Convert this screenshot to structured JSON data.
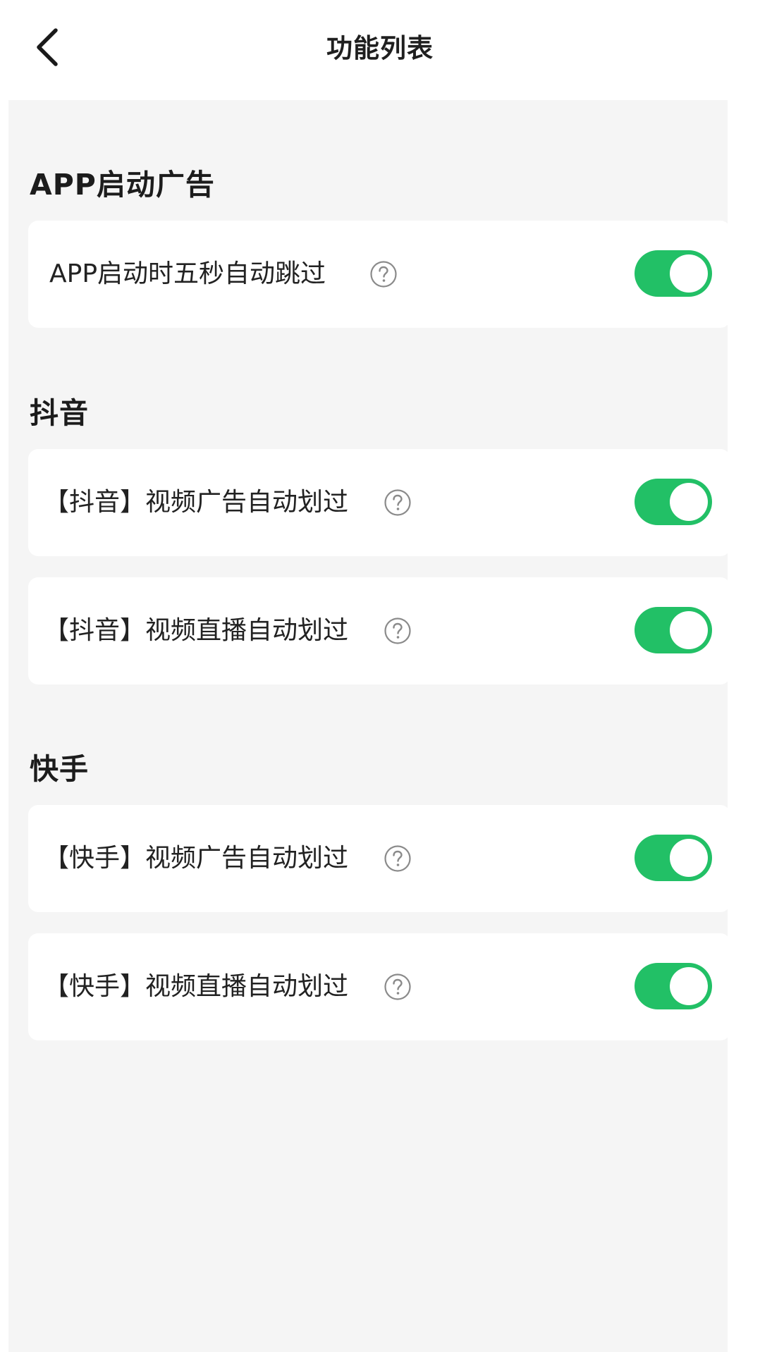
{
  "header": {
    "title": "功能列表",
    "back_icon": "chevron-left-icon"
  },
  "colors": {
    "toggle_on": "#22c066",
    "background": "#f5f5f5",
    "card": "#ffffff"
  },
  "sections": [
    {
      "title": "APP启动广告",
      "items": [
        {
          "label": "APP启动时五秒自动跳过",
          "enabled": true,
          "help_icon": "question-circle-icon"
        }
      ]
    },
    {
      "title": "抖音",
      "items": [
        {
          "label": "【抖音】视频广告自动划过",
          "enabled": true,
          "help_icon": "question-circle-icon"
        },
        {
          "label": "【抖音】视频直播自动划过",
          "enabled": true,
          "help_icon": "question-circle-icon"
        }
      ]
    },
    {
      "title": "快手",
      "items": [
        {
          "label": "【快手】视频广告自动划过",
          "enabled": true,
          "help_icon": "question-circle-icon"
        },
        {
          "label": "【快手】视频直播自动划过",
          "enabled": true,
          "help_icon": "question-circle-icon"
        }
      ]
    }
  ]
}
